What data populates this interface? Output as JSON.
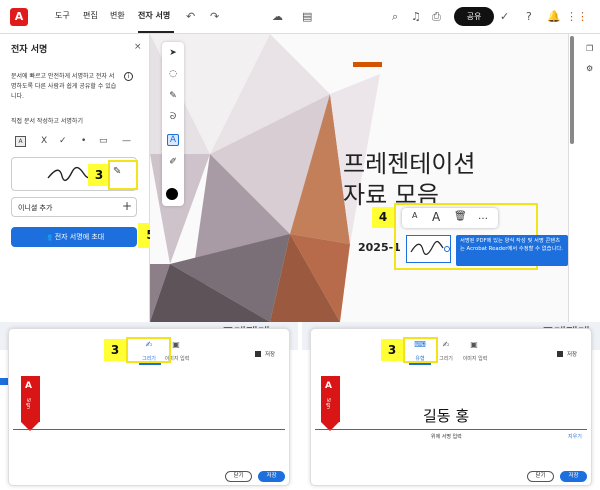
{
  "toolbar": {
    "menus": [
      "도구",
      "편집",
      "변환",
      "전자 서명"
    ],
    "active_menu": "전자 서명",
    "share_label": "공유"
  },
  "sidebar": {
    "title": "전자 서명",
    "description": "문서에 빠르고 안전하게 서명하고 전자 서명하도록 다른 사람과 쉽게 공유할 수 있습니다.",
    "self_sign_label": "직접 문서 작성하고 서명하기",
    "tools": [
      "A",
      "X",
      "✓",
      "•",
      "▭",
      "—"
    ],
    "signature_text": "tre",
    "add_initials_label": "이니셜 추가",
    "invite_button_label": "전자 서명에 초대"
  },
  "callouts": {
    "sig_card": "3",
    "float_bar": "4",
    "invite": "5",
    "draw_tab": "3",
    "type_tab": "3"
  },
  "slide": {
    "title_line1": "프레젠테이션",
    "title_line2": "자료 모음",
    "date": "2025-1",
    "float_tools": [
      "A",
      "A",
      "🗑",
      "…"
    ],
    "tooltip": "서명된 PDF에 있는 양식 작성 및 서명 콘텐츠는 Acrobat Reader에서 수정할 수 없습니다."
  },
  "draw_dialog": {
    "tabs": [
      "그리기",
      "이미지 입력"
    ],
    "save_label": "저장",
    "close_button": "닫기",
    "save_button": "저장"
  },
  "type_dialog": {
    "tabs": [
      "유형",
      "그리기",
      "이미지 입력"
    ],
    "save_label": "저장",
    "typed_name": "길동 홍",
    "hint": "위에 서명 입력",
    "clear_link": "지우기",
    "close_button": "닫기",
    "save_button": "저장"
  },
  "background_text": {
    "left": "프레젠테",
    "right": "프레젠테"
  },
  "colors": {
    "accent": "#1c6fdc",
    "callout": "#ffff33",
    "adobe_red": "#e01b1b"
  }
}
